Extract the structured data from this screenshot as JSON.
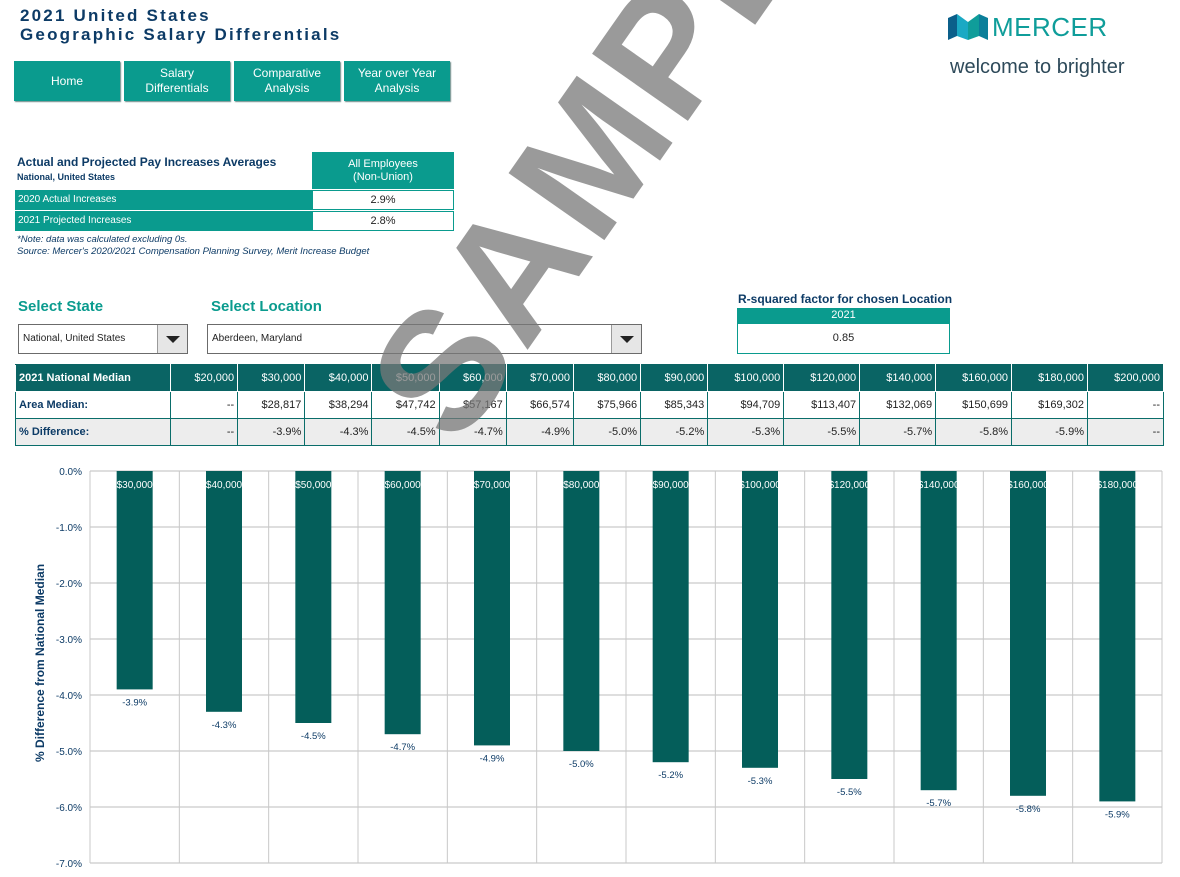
{
  "title": {
    "line1": "2021 United States",
    "line2": "Geographic Salary Differentials"
  },
  "logo": {
    "wordmark": "MERCER",
    "tagline": "welcome to brighter",
    "brand_color": "#0f9d9a"
  },
  "nav": [
    {
      "label": "Home"
    },
    {
      "label": "Salary\nDifferentials"
    },
    {
      "label": "Comparative\nAnalysis"
    },
    {
      "label": "Year over Year\nAnalysis"
    }
  ],
  "pay_increases": {
    "title": "Actual and Projected Pay Increases Averages",
    "subtitle": "National, United States",
    "column_header": "All Employees\n(Non-Union)",
    "rows": [
      {
        "label": "2020 Actual Increases",
        "value": "2.9%"
      },
      {
        "label": "2021 Projected Increases",
        "value": "2.8%"
      }
    ],
    "note": "*Note: data was calculated excluding 0s.",
    "source": "Source: Mercer's 2020/2021 Compensation Planning Survey, Merit Increase Budget"
  },
  "select_state": {
    "label": "Select State",
    "value": "National, United States"
  },
  "select_location": {
    "label": "Select Location",
    "value": "Aberdeen, Maryland"
  },
  "r_squared": {
    "title": "R-squared factor for chosen Location",
    "year": "2021",
    "value": "0.85"
  },
  "salary_table": {
    "header_label": "2021 National Median",
    "columns": [
      "$20,000",
      "$30,000",
      "$40,000",
      "$50,000",
      "$60,000",
      "$70,000",
      "$80,000",
      "$90,000",
      "$100,000",
      "$120,000",
      "$140,000",
      "$160,000",
      "$180,000",
      "$200,000"
    ],
    "rows": [
      {
        "label": "Area Median:",
        "cells": [
          "--",
          "$28,817",
          "$38,294",
          "$47,742",
          "$57,167",
          "$66,574",
          "$75,966",
          "$85,343",
          "$94,709",
          "$113,407",
          "$132,069",
          "$150,699",
          "$169,302",
          "--"
        ]
      },
      {
        "label": "% Difference:",
        "cells": [
          "--",
          "-3.9%",
          "-4.3%",
          "-4.5%",
          "-4.7%",
          "-4.9%",
          "-5.0%",
          "-5.2%",
          "-5.3%",
          "-5.5%",
          "-5.7%",
          "-5.8%",
          "-5.9%",
          "--"
        ]
      }
    ]
  },
  "watermark": "SAMPLE",
  "chart_data": {
    "type": "bar",
    "categories": [
      "$30,000",
      "$40,000",
      "$50,000",
      "$60,000",
      "$70,000",
      "$80,000",
      "$90,000",
      "$100,000",
      "$120,000",
      "$140,000",
      "$160,000",
      "$180,000"
    ],
    "values": [
      -3.9,
      -4.3,
      -4.5,
      -4.7,
      -4.9,
      -5.0,
      -5.2,
      -5.3,
      -5.5,
      -5.7,
      -5.8,
      -5.9
    ],
    "data_labels": [
      "-3.9%",
      "-4.3%",
      "-4.5%",
      "-4.7%",
      "-4.9%",
      "-5.0%",
      "-5.2%",
      "-5.3%",
      "-5.5%",
      "-5.7%",
      "-5.8%",
      "-5.9%"
    ],
    "ylabel": "% Difference from National Median",
    "ylim": [
      -7.0,
      0.0
    ],
    "yticks": [
      "0.0%",
      "-1.0%",
      "-2.0%",
      "-3.0%",
      "-4.0%",
      "-5.0%",
      "-6.0%",
      "-7.0%"
    ],
    "grid": true,
    "bar_color": "#045e5a"
  }
}
